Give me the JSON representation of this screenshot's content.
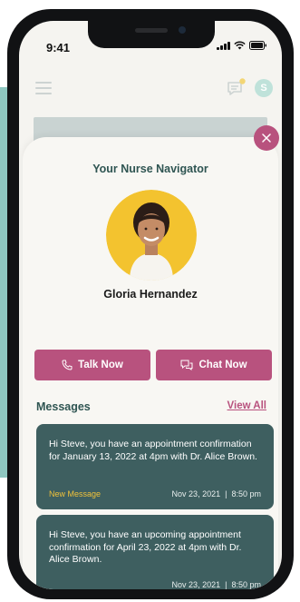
{
  "status_bar": {
    "time": "9:41"
  },
  "header": {
    "avatar_initial": "S"
  },
  "navigator": {
    "title": "Your Nurse Navigator",
    "name": "Gloria Hernandez"
  },
  "actions": {
    "talk_label": "Talk Now",
    "chat_label": "Chat Now"
  },
  "messages": {
    "title": "Messages",
    "view_all": "View All",
    "items": [
      {
        "text": "Hi Steve, you have an appointment confirmation for January 13, 2022 at 4pm with Dr. Alice Brown.",
        "badge": "New Message",
        "date": "Nov 23, 2021",
        "time": "8:50 pm"
      },
      {
        "text": "Hi Steve, you have an upcoming appointment confirmation for April 23, 2022 at 4pm with Dr. Alice Brown.",
        "badge": "",
        "date": "Nov 23, 2021",
        "time": "8:50 pm"
      }
    ]
  },
  "colors": {
    "accent": "#b8527e",
    "teal_dark": "#3e5f60",
    "heading": "#2f5552",
    "badge_new": "#f0c23a",
    "sheet_bg": "#f8f7f3"
  },
  "icons": [
    "hamburger-icon",
    "chat-bubble-icon",
    "close-icon",
    "phone-icon",
    "chat-icon",
    "signal-icon",
    "wifi-icon",
    "battery-icon"
  ]
}
